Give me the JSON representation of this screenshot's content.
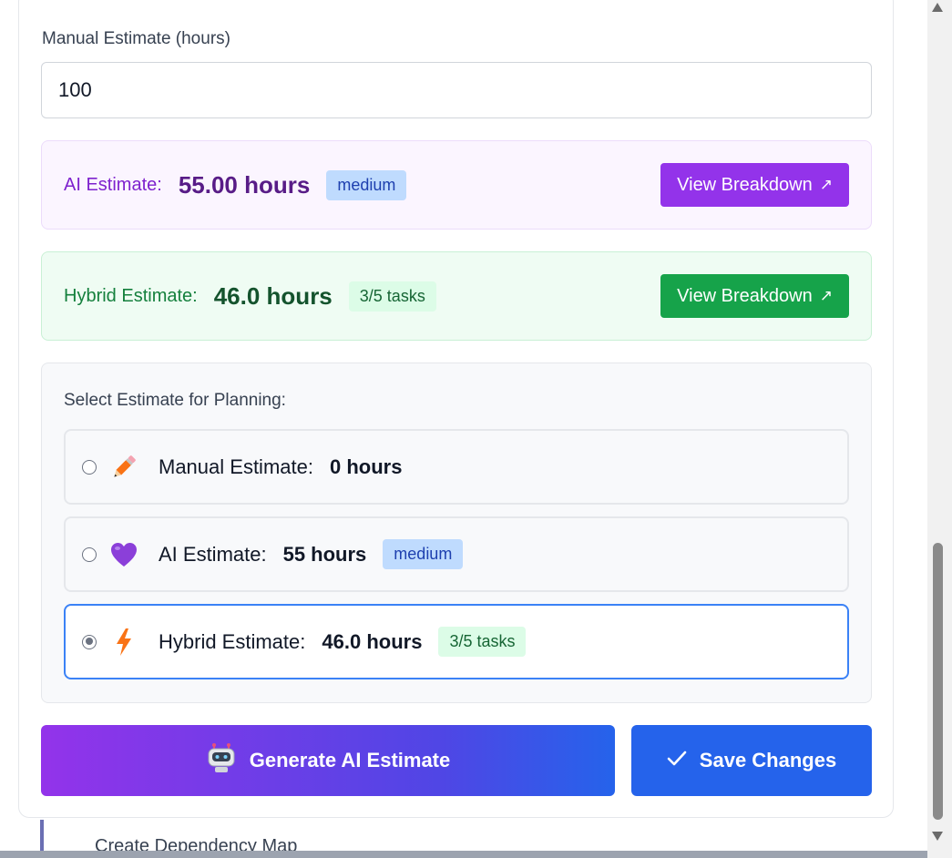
{
  "manual_input": {
    "label": "Manual Estimate (hours)",
    "value": "100"
  },
  "ai_estimate": {
    "label": "AI Estimate:",
    "value": "55.00 hours",
    "badge": "medium",
    "button": "View Breakdown",
    "button_icon": "↗"
  },
  "hybrid_estimate": {
    "label": "Hybrid Estimate:",
    "value": "46.0 hours",
    "badge": "3/5 tasks",
    "button": "View Breakdown",
    "button_icon": "↗"
  },
  "selection": {
    "title": "Select Estimate for Planning:",
    "options": [
      {
        "icon": "pencil-icon",
        "label": "Manual Estimate:",
        "value": "0 hours",
        "badge": "",
        "selected": false
      },
      {
        "icon": "purple-heart-icon",
        "label": "AI Estimate:",
        "value": "55 hours",
        "badge": "medium",
        "selected": false
      },
      {
        "icon": "lightning-icon",
        "label": "Hybrid Estimate:",
        "value": "46.0 hours",
        "badge": "3/5 tasks",
        "selected": true
      }
    ]
  },
  "actions": {
    "generate_label": "Generate AI Estimate",
    "generate_icon": "robot-icon",
    "save_label": "Save Changes",
    "save_icon": "checkmark-icon"
  },
  "background": {
    "peek_text": "Create Dependency Map"
  },
  "colors": {
    "purple": "#9333ea",
    "green": "#16a34a",
    "blue": "#2563eb",
    "selected_border": "#3b82f6"
  }
}
